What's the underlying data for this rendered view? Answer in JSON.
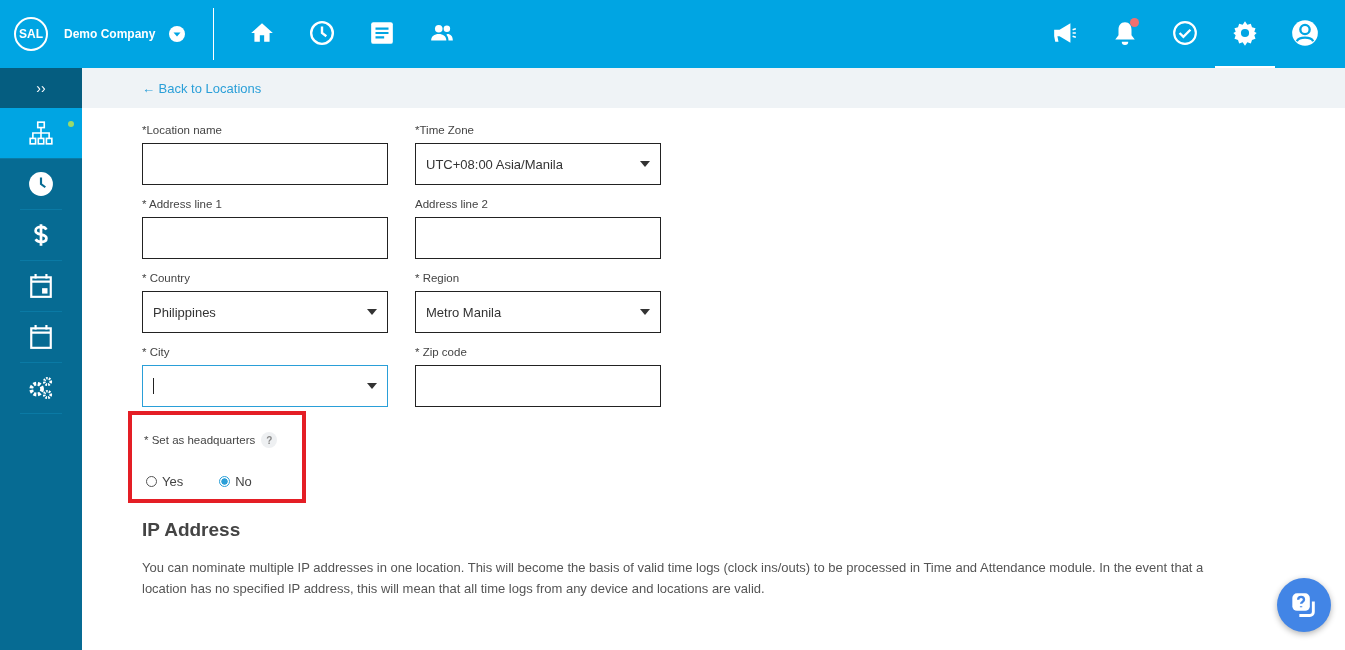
{
  "header": {
    "logo": "SAL",
    "company": "Demo Company",
    "nav": [
      {
        "kind": "home",
        "selected": false
      },
      {
        "kind": "clock",
        "selected": false
      },
      {
        "kind": "document",
        "selected": false
      },
      {
        "kind": "people",
        "selected": false
      }
    ],
    "actions": [
      {
        "kind": "megaphone",
        "dot": false,
        "selected": false
      },
      {
        "kind": "bell",
        "dot": true,
        "selected": false
      },
      {
        "kind": "check",
        "dot": false,
        "selected": false
      },
      {
        "kind": "gear",
        "dot": false,
        "selected": true
      },
      {
        "kind": "user",
        "dot": false,
        "selected": false
      }
    ]
  },
  "sidebar": {
    "toggle": "››",
    "items": [
      {
        "kind": "hierarchy",
        "selected": true,
        "dot": true
      },
      {
        "kind": "clock",
        "selected": false,
        "dot": false
      },
      {
        "kind": "dollar",
        "selected": false,
        "dot": false
      },
      {
        "kind": "calendar-day",
        "selected": false,
        "dot": false
      },
      {
        "kind": "calendar",
        "selected": false,
        "dot": false
      },
      {
        "kind": "gears",
        "selected": false,
        "dot": false
      }
    ]
  },
  "back_link": "← Back to Locations",
  "fields": [
    {
      "label": "*Location name",
      "kind": "text",
      "focused": false
    },
    {
      "label": "*Time Zone",
      "kind": "select",
      "value": "UTC+08:00 Asia/Manila",
      "focused": false
    },
    {
      "label": "* Address line 1",
      "kind": "text",
      "focused": false
    },
    {
      "label": "Address line 2",
      "kind": "text",
      "focused": false
    },
    {
      "label": "* Country",
      "kind": "select",
      "value": "Philippines",
      "focused": false
    },
    {
      "label": "* Region",
      "kind": "select",
      "value": "Metro Manila",
      "focused": false
    },
    {
      "label": "* City",
      "kind": "select",
      "focused": true
    },
    {
      "label": "* Zip code",
      "kind": "text",
      "focused": false
    }
  ],
  "headquarters": {
    "label": "* Set as headquarters",
    "help": "?",
    "highlighted": true,
    "options": [
      {
        "label": "Yes",
        "selected": false
      },
      {
        "label": "No",
        "selected": true
      }
    ]
  },
  "ip_section": {
    "title": "IP Address",
    "description": "You can nominate multiple IP addresses in one location. This will become the basis of valid time logs (clock ins/outs) to be processed in Time and Attendance module. In the event that a location has no specified IP address, this will mean that all time logs from any device and locations are valid."
  }
}
